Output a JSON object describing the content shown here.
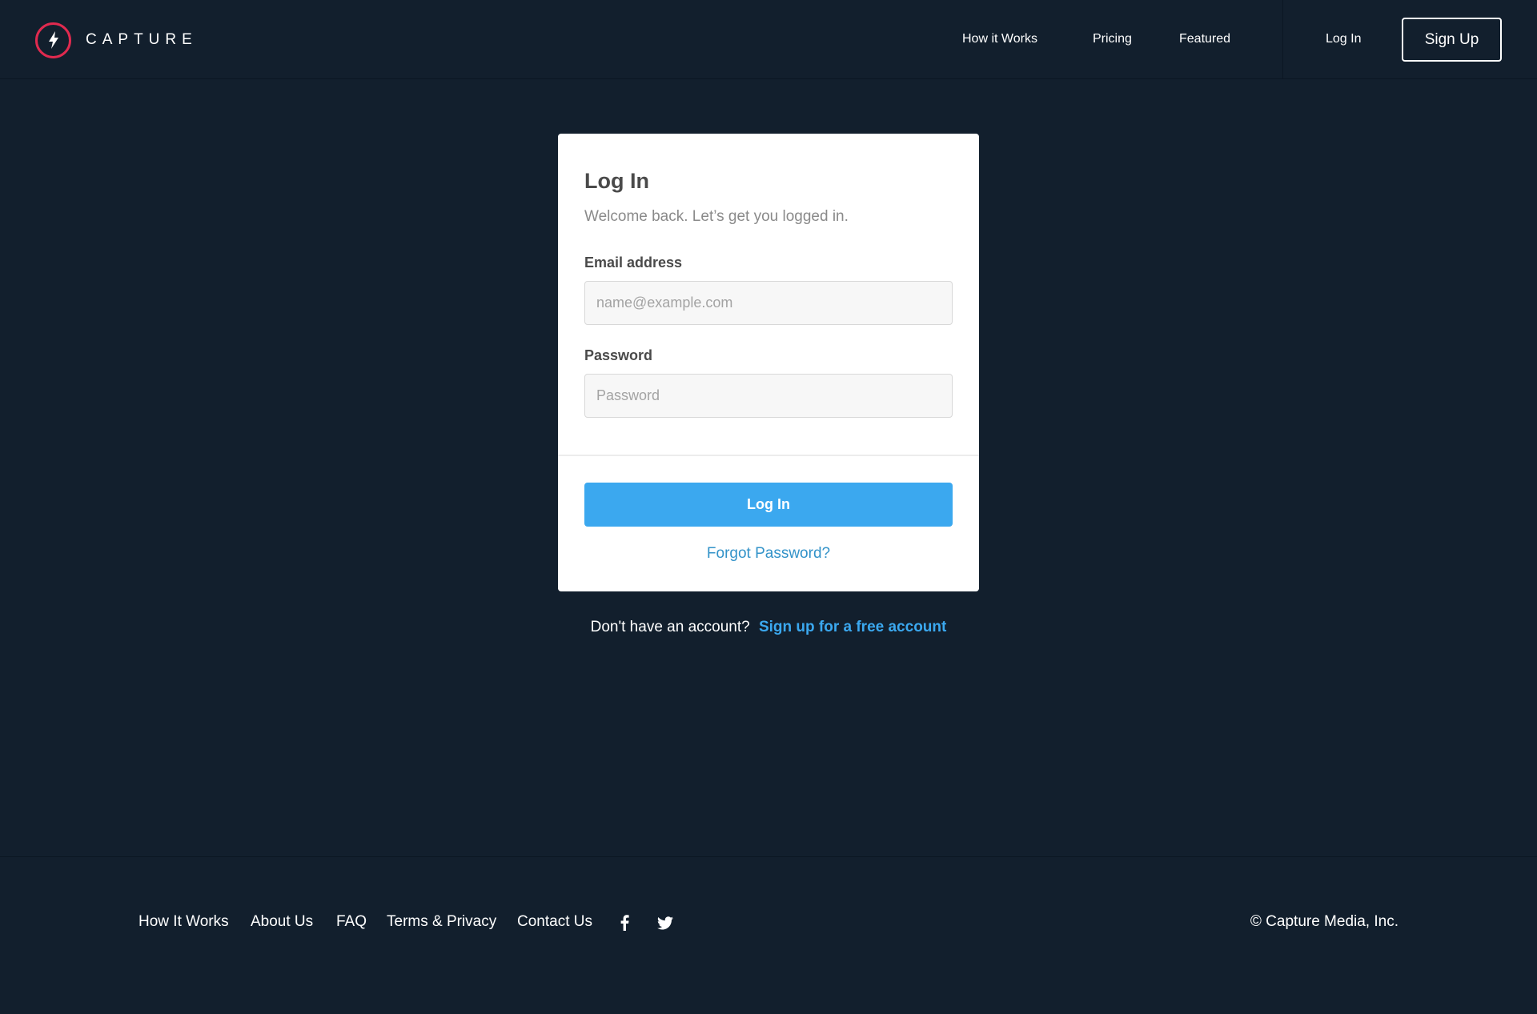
{
  "brand": {
    "name": "CAPTURE",
    "icon": "lightning-bolt-icon",
    "accent_color": "#e02a4f"
  },
  "nav": {
    "links": [
      "How it Works",
      "Pricing",
      "Featured"
    ],
    "login_label": "Log In",
    "signup_label": "Sign Up"
  },
  "login_card": {
    "title": "Log In",
    "subtitle": "Welcome back. Let’s get you logged in.",
    "email_label": "Email address",
    "email_placeholder": "name@example.com",
    "email_value": "",
    "password_label": "Password",
    "password_placeholder": "Password",
    "password_value": "",
    "submit_label": "Log In",
    "forgot_label": "Forgot Password?",
    "button_color": "#3ba8ef"
  },
  "signup_prompt": {
    "text": "Don't have an account?",
    "link_label": "Sign up for a free account"
  },
  "footer": {
    "links": [
      "How It Works",
      "About Us",
      "FAQ",
      "Terms & Privacy",
      "Contact Us"
    ],
    "social": [
      "facebook-icon",
      "twitter-icon"
    ],
    "copyright": "© Capture Media, Inc."
  },
  "colors": {
    "background": "#121f2d",
    "link": "#3ba8ef"
  }
}
